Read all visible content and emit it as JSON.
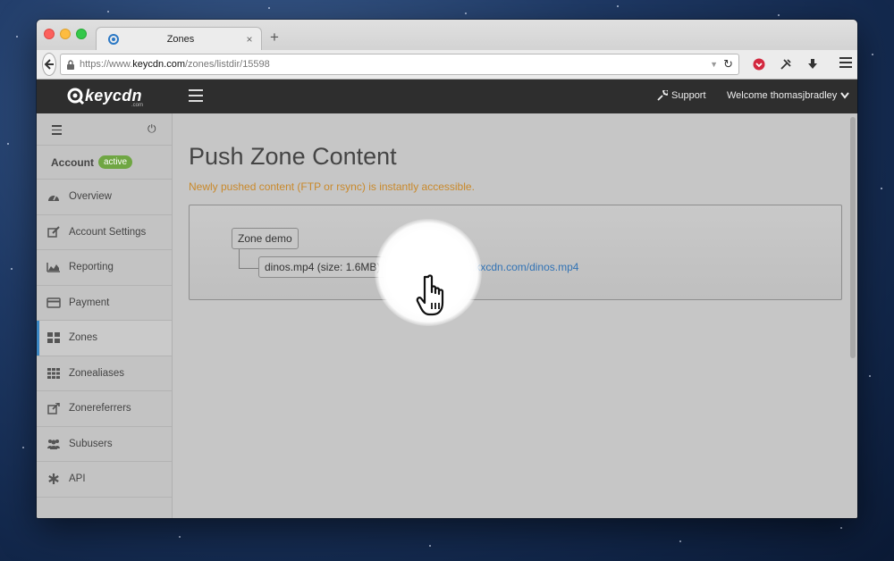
{
  "browser": {
    "tab_title": "Zones",
    "tab_close": "×",
    "new_tab": "+",
    "url_prefix": "https://www.",
    "url_domain": "keycdn.com",
    "url_path": "/zones/listdir/15598"
  },
  "app": {
    "logo_text": "keycdn",
    "logo_sub": ".com",
    "support_label": "Support",
    "welcome_label": "Welcome thomasjbradley"
  },
  "sidebar": {
    "account_label": "Account",
    "account_status": "active",
    "items": [
      {
        "label": "Overview",
        "icon": "dashboard-icon"
      },
      {
        "label": "Account Settings",
        "icon": "edit-icon"
      },
      {
        "label": "Reporting",
        "icon": "chart-icon"
      },
      {
        "label": "Payment",
        "icon": "credit-card-icon"
      },
      {
        "label": "Zones",
        "icon": "grid-icon",
        "active": true
      },
      {
        "label": "Zonealiases",
        "icon": "grid-dots-icon"
      },
      {
        "label": "Zonereferrers",
        "icon": "external-link-icon"
      },
      {
        "label": "Subusers",
        "icon": "users-icon"
      },
      {
        "label": "API",
        "icon": "asterisk-icon"
      }
    ]
  },
  "main": {
    "title": "Push Zone Content",
    "subtitle": "Newly pushed content (FTP or rsync) is instantly accessible.",
    "zone_name": "Zone demo",
    "file_label": "dinos.mp4 (size: 1.6MB)",
    "file_url": "http://demo-1d8c.kxcdn.com/dinos.mp4"
  },
  "colors": {
    "accent_link": "#3273b5",
    "badge_green": "#6fa643",
    "subtitle_orange": "#c9892b",
    "appbar_dark": "#2e2e2e"
  }
}
